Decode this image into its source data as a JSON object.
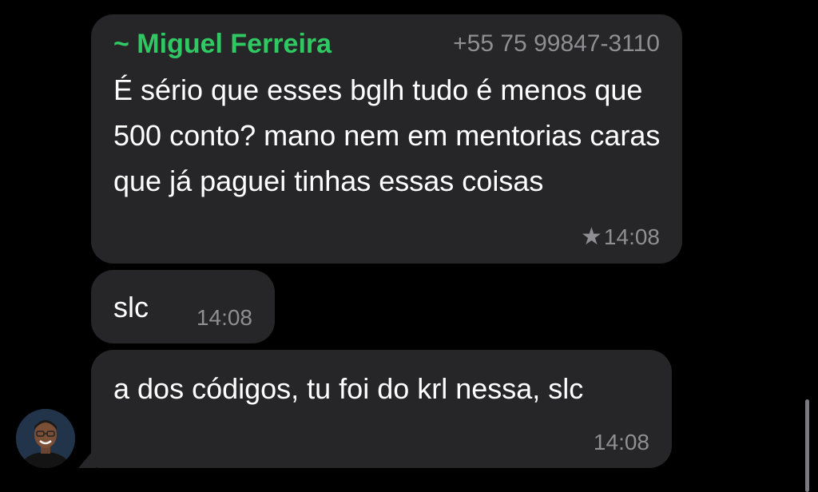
{
  "messages": [
    {
      "sender_name": "~ Miguel Ferreira",
      "sender_phone": "+55 75 99847-3110",
      "text": "É sério que esses bglh tudo é menos que 500 conto? mano nem em mentorias caras que já paguei tinhas essas coisas",
      "time": "14:08",
      "starred": true,
      "star_icon": "★"
    },
    {
      "text": "slc",
      "time": "14:08"
    },
    {
      "text": "a dos códigos, tu foi do krl nessa, slc",
      "time": "14:08"
    }
  ],
  "colors": {
    "background": "#000000",
    "bubble": "#262628",
    "sender_name": "#2fc862",
    "meta_text": "#8e8e93"
  },
  "icons": {
    "star": "star-icon",
    "avatar": "avatar"
  }
}
